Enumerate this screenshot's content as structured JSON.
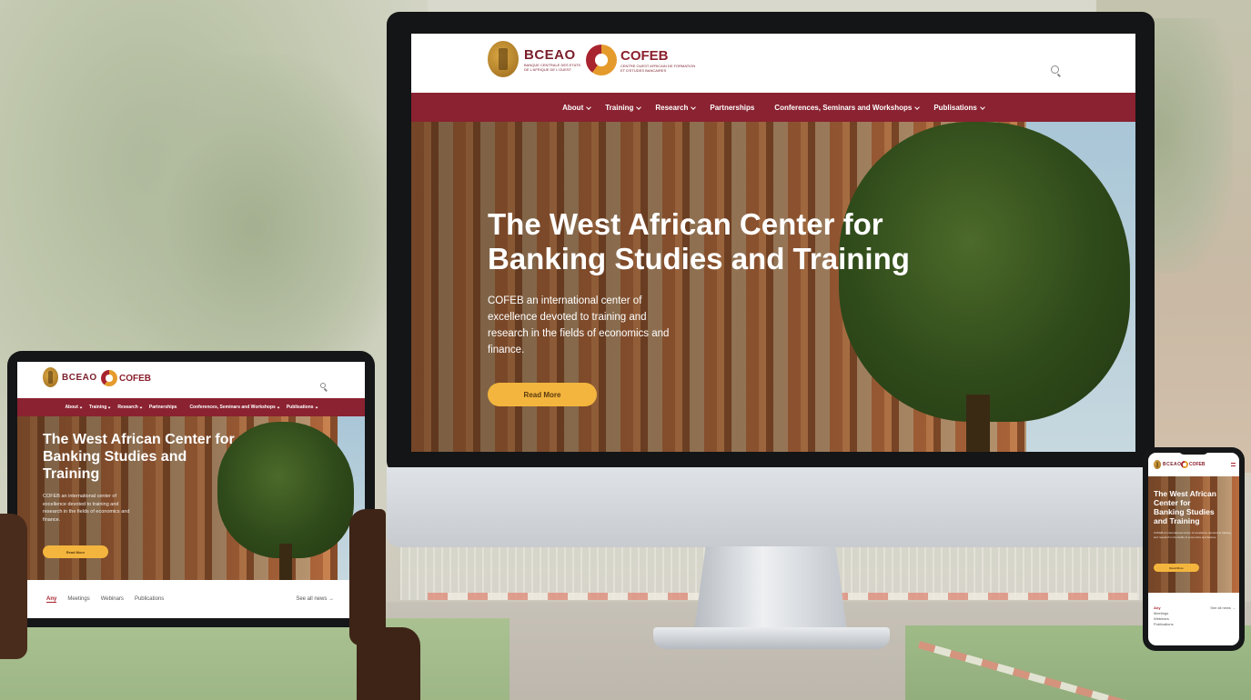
{
  "brand": {
    "bceao": "BCEAO",
    "bceao_sub_1": "BANQUE CENTRALE DES ETATS",
    "bceao_sub_2": "DE L'AFRIQUE DE L'OUEST",
    "cofeb": "COFEB",
    "cofeb_sub_1": "CENTRE OUEST AFRICAIN DE FORMATION",
    "cofeb_sub_2": "ET D'ETUDES BANCAIRES"
  },
  "nav": {
    "items": [
      "About",
      "Training",
      "Research",
      "Partnerships",
      "Conferences, Seminars and Workshops",
      "Publisations"
    ],
    "has_dropdown": [
      true,
      true,
      true,
      false,
      true,
      true
    ]
  },
  "hero": {
    "title_line1": "The West African Center for",
    "title_line2": "Banking Studies and Training",
    "tablet_title_1": "The West African Center for",
    "tablet_title_2": "Banking Studies and",
    "tablet_title_3": "Training",
    "phone_title_1": "The West African",
    "phone_title_2": "Center for",
    "phone_title_3": "Banking Studies",
    "phone_title_4": "and Training",
    "desc_1": "COFEB an international center of",
    "desc_2": "excellence devoted to training and",
    "desc_3": "research in the fields of economics and",
    "desc_4": "finance.",
    "cta": "Read More"
  },
  "news": {
    "tabs": [
      "Any",
      "Meetings",
      "Webinars",
      "Publications"
    ],
    "active_tab": "Any",
    "see_all": "See all news →"
  },
  "colors": {
    "brand_red": "#8a2231",
    "accent_yellow": "#f3b53d"
  },
  "icons": {
    "search": "search-icon",
    "chevron": "chevron-down-icon"
  }
}
